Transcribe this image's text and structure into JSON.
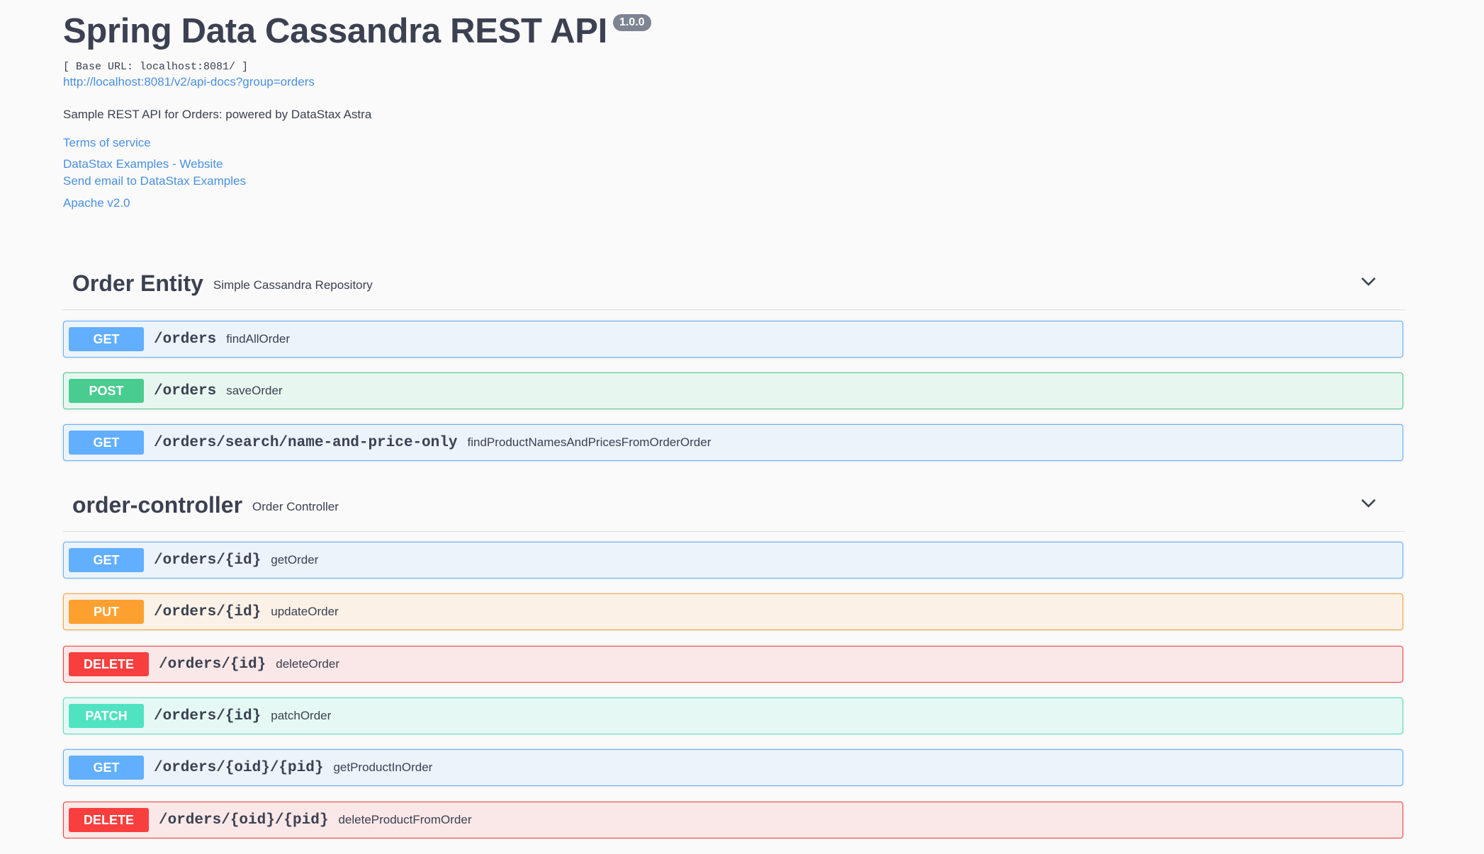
{
  "info": {
    "title": "Spring Data Cassandra REST API",
    "version": "1.0.0",
    "base_url": "[ Base URL: localhost:8081/ ]",
    "spec_link": "http://localhost:8081/v2/api-docs?group=orders",
    "description": "Sample REST API for Orders: powered by DataStax Astra",
    "terms_of_service": "Terms of service",
    "contact_website": "DataStax Examples - Website",
    "contact_email": "Send email to DataStax Examples",
    "license": "Apache v2.0"
  },
  "sections": [
    {
      "name": "Order Entity",
      "description": "Simple Cassandra Repository",
      "operations": [
        {
          "method": "GET",
          "path": "/orders",
          "summary": "findAllOrder"
        },
        {
          "method": "POST",
          "path": "/orders",
          "summary": "saveOrder"
        },
        {
          "method": "GET",
          "path": "/orders/search/name-and-price-only",
          "summary": "findProductNamesAndPricesFromOrderOrder"
        }
      ]
    },
    {
      "name": "order-controller",
      "description": "Order Controller",
      "operations": [
        {
          "method": "GET",
          "path": "/orders/{id}",
          "summary": "getOrder"
        },
        {
          "method": "PUT",
          "path": "/orders/{id}",
          "summary": "updateOrder"
        },
        {
          "method": "DELETE",
          "path": "/orders/{id}",
          "summary": "deleteOrder"
        },
        {
          "method": "PATCH",
          "path": "/orders/{id}",
          "summary": "patchOrder"
        },
        {
          "method": "GET",
          "path": "/orders/{oid}/{pid}",
          "summary": "getProductInOrder"
        },
        {
          "method": "DELETE",
          "path": "/orders/{oid}/{pid}",
          "summary": "deleteProductFromOrder"
        }
      ]
    }
  ],
  "colors": {
    "get": "#61affe",
    "post": "#49cc90",
    "put": "#fca130",
    "delete": "#f93e3e",
    "patch": "#50e3c2",
    "link": "#4990e2",
    "text": "#3b4151"
  }
}
